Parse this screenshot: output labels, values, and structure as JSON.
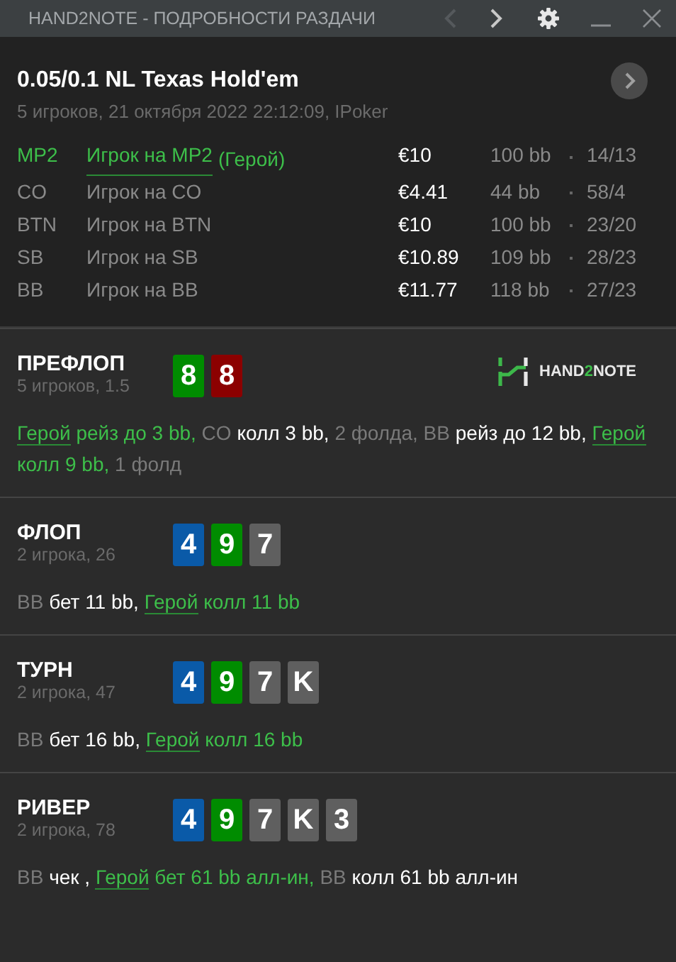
{
  "window": {
    "title": "HAND2NOTE - ПОДРОБНОСТИ РАЗДАЧИ",
    "prev": {
      "disabled": true
    },
    "next": {
      "disabled": false
    }
  },
  "hand": {
    "title": "0.05/0.1 NL Texas Hold'em",
    "subtitle": "5 игроков, 21 октября 2022 22:12:09, IPoker",
    "players": [
      {
        "position": "MP2",
        "name": "Игрок на MP2",
        "tag": "(Герой)",
        "hero": true,
        "stack": "€10",
        "bb": "100 bb",
        "stats": "14/13"
      },
      {
        "position": "CO",
        "name": "Игрок на CO",
        "hero": false,
        "stack": "€4.41",
        "bb": "44 bb",
        "stats": "58/4"
      },
      {
        "position": "BTN",
        "name": "Игрок на BTN",
        "hero": false,
        "stack": "€10",
        "bb": "100 bb",
        "stats": "23/20"
      },
      {
        "position": "SB",
        "name": "Игрок на SB",
        "hero": false,
        "stack": "€10.89",
        "bb": "109 bb",
        "stats": "28/23"
      },
      {
        "position": "BB",
        "name": "Игрок на BB",
        "hero": false,
        "stack": "€11.77",
        "bb": "118 bb",
        "stats": "27/23"
      }
    ]
  },
  "logo": {
    "parts": [
      {
        "text": "HAND",
        "kind": "plain"
      },
      {
        "text": "2",
        "kind": "accent"
      },
      {
        "text": "NOTE",
        "kind": "plain"
      }
    ]
  },
  "streets": [
    {
      "name": "ПРЕФЛОП",
      "info": "5 игроков, 1.5",
      "cards": [
        {
          "rank": "8",
          "color": "#008c00"
        },
        {
          "rank": "8",
          "color": "#8c0000"
        }
      ],
      "actions": [
        {
          "kind": "hero-link",
          "text": "Герой"
        },
        {
          "kind": "hero",
          "text": "рейз до 3 bb,"
        },
        {
          "kind": "name",
          "text": "CO"
        },
        {
          "kind": "action",
          "text": "колл 3 bb,"
        },
        {
          "kind": "name",
          "text": "2 фолда,"
        },
        {
          "kind": "name",
          "text": "BB"
        },
        {
          "kind": "action",
          "text": "рейз до 12 bb,"
        },
        {
          "kind": "hero-link",
          "text": "Герой"
        },
        {
          "kind": "hero",
          "text": "колл 9 bb,"
        },
        {
          "kind": "name",
          "text": "1 фолд"
        }
      ]
    },
    {
      "name": "ФЛОП",
      "info": "2 игрока, 26",
      "cards": [
        {
          "rank": "4",
          "color": "#0a5aa8"
        },
        {
          "rank": "9",
          "color": "#008c00"
        },
        {
          "rank": "7",
          "color": "#5f5f5f"
        }
      ],
      "actions": [
        {
          "kind": "name",
          "text": "BB"
        },
        {
          "kind": "action",
          "text": "бет 11 bb,"
        },
        {
          "kind": "hero-link",
          "text": "Герой"
        },
        {
          "kind": "hero",
          "text": "колл 11 bb"
        }
      ]
    },
    {
      "name": "ТУРН",
      "info": "2 игрока, 47",
      "cards": [
        {
          "rank": "4",
          "color": "#0a5aa8"
        },
        {
          "rank": "9",
          "color": "#008c00"
        },
        {
          "rank": "7",
          "color": "#5f5f5f"
        },
        {
          "rank": "K",
          "color": "#5f5f5f"
        }
      ],
      "actions": [
        {
          "kind": "name",
          "text": "BB"
        },
        {
          "kind": "action",
          "text": "бет 16 bb,"
        },
        {
          "kind": "hero-link",
          "text": "Герой"
        },
        {
          "kind": "hero",
          "text": "колл 16 bb"
        }
      ]
    },
    {
      "name": "РИВЕР",
      "info": "2 игрока, 78",
      "cards": [
        {
          "rank": "4",
          "color": "#0a5aa8"
        },
        {
          "rank": "9",
          "color": "#008c00"
        },
        {
          "rank": "7",
          "color": "#5f5f5f"
        },
        {
          "rank": "K",
          "color": "#5f5f5f"
        },
        {
          "rank": "3",
          "color": "#5f5f5f"
        }
      ],
      "actions": [
        {
          "kind": "name",
          "text": "BB"
        },
        {
          "kind": "action",
          "text": "чек ,"
        },
        {
          "kind": "hero-link",
          "text": "Герой"
        },
        {
          "kind": "hero",
          "text": "бет 61 bb алл-ин,"
        },
        {
          "kind": "name",
          "text": "BB"
        },
        {
          "kind": "action",
          "text": "колл 61 bb алл-ин"
        }
      ]
    }
  ]
}
